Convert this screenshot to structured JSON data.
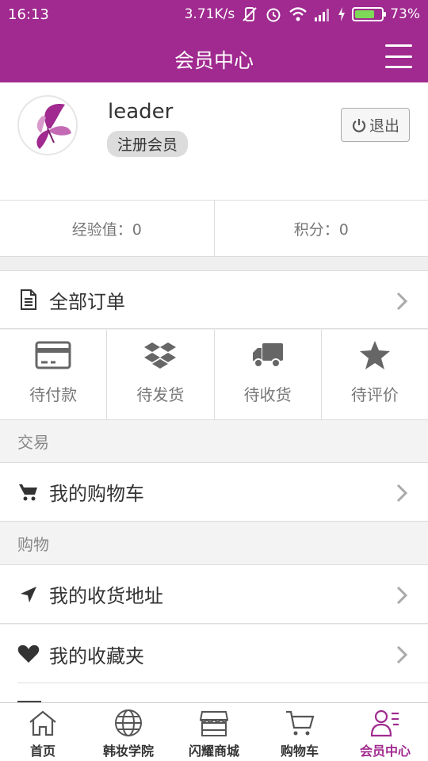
{
  "status_bar": {
    "time": "16:13",
    "speed": "3.71K/s",
    "battery": "73%",
    "battery_level": 0.73
  },
  "header": {
    "title": "会员中心"
  },
  "profile": {
    "username": "leader",
    "member_level": "注册会员",
    "logout_label": "退出"
  },
  "stats": {
    "experience": "经验值：0",
    "points": "积分：0"
  },
  "orders": {
    "all_label": "全部订单",
    "items": [
      {
        "label": "待付款",
        "icon": "card-icon"
      },
      {
        "label": "待发货",
        "icon": "box-icon"
      },
      {
        "label": "待收货",
        "icon": "truck-icon"
      },
      {
        "label": "待评价",
        "icon": "star-icon"
      }
    ]
  },
  "sections": {
    "trade": {
      "title": "交易",
      "items": [
        {
          "label": "我的购物车",
          "icon": "cart-icon"
        }
      ]
    },
    "shopping": {
      "title": "购物",
      "items": [
        {
          "label": "我的收货地址",
          "icon": "location-arrow-icon"
        },
        {
          "label": "我的收藏夹",
          "icon": "heart-icon"
        }
      ]
    }
  },
  "tab_bar": {
    "items": [
      {
        "label": "首页",
        "icon": "home-icon"
      },
      {
        "label": "韩妆学院",
        "icon": "globe-icon"
      },
      {
        "label": "闪耀商城",
        "icon": "store-icon"
      },
      {
        "label": "购物车",
        "icon": "cart-outline-icon"
      },
      {
        "label": "会员中心",
        "icon": "member-icon",
        "active": true
      }
    ]
  },
  "colors": {
    "brand": "#a02a8f",
    "text": "#333333",
    "muted": "#777777",
    "divider": "#dddddd"
  }
}
